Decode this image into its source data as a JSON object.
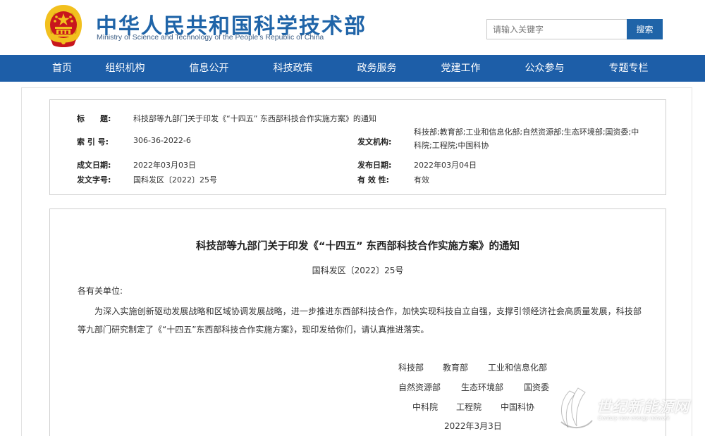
{
  "header": {
    "title": "中华人民共和国科学技术部",
    "subtitle": "Ministry of Science and Technology of the People's Republic of China",
    "search_placeholder": "请输入关键字",
    "search_button": "搜索"
  },
  "nav": {
    "items": [
      "首页",
      "组织机构",
      "信息公开",
      "科技政策",
      "政务服务",
      "党建工作",
      "公众参与",
      "专题专栏"
    ]
  },
  "meta": {
    "title_label": "标　　题:",
    "title_value": "科技部等九部门关于印发《“十四五” 东西部科技合作实施方案》的通知",
    "index_label": "索 引 号:",
    "index_value": "306-36-2022-6",
    "issuer_label": "发文机构:",
    "issuer_value": "科技部;教育部;工业和信息化部;自然资源部;生态环境部;国资委;中科院;工程院;中国科协",
    "created_label": "成文日期:",
    "created_value": "2022年03月03日",
    "published_label": "发布日期:",
    "published_value": "2022年03月04日",
    "docno_label": "发文字号:",
    "docno_value": "国科发区〔2022〕25号",
    "validity_label": "有 效 性:",
    "validity_value": "有效"
  },
  "document": {
    "title": "科技部等九部门关于印发《“十四五” 东西部科技合作实施方案》的通知",
    "number": "国科发区〔2022〕25号",
    "salutation": "各有关单位:",
    "paragraph": "为深入实施创新驱动发展战略和区域协调发展战略，进一步推进东西部科技合作，加快实现科技自立自强，支撑引领经济社会高质量发展，科技部等九部门研究制定了《“十四五”东西部科技合作实施方案》，现印发给你们，请认真推进落实。",
    "signatories": {
      "row1": [
        "科技部",
        "教育部",
        "工业和信息化部"
      ],
      "row2": [
        "自然资源部",
        "生态环境部",
        "国资委"
      ],
      "row3": [
        "中科院",
        "工程院",
        "中国科协"
      ]
    },
    "date": "2022年3月3日"
  },
  "watermark": {
    "text": "世纪新能源网",
    "subtext": "Century new energy network"
  },
  "colors": {
    "brand_blue": "#1f64a8",
    "nav_blue": "#1d5ea8",
    "emblem_red": "#c8161d",
    "emblem_gold": "#f2c01e"
  }
}
